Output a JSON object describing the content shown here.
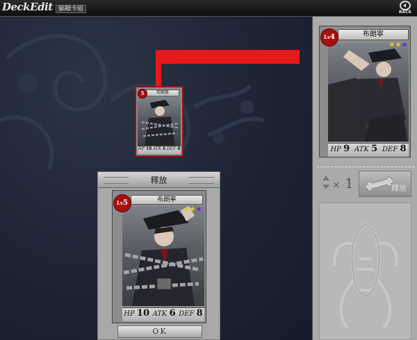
{
  "header": {
    "logo_text": "DeckEdit",
    "sub_label": "編輯卡組",
    "back_label": "BACK",
    "back_icon": "back-circle-arrow-icon"
  },
  "colors": {
    "arrow": "#e81818",
    "background": "#1c2333",
    "panel": "#aaaaaa",
    "level_badge": "#a81010"
  },
  "small_card": {
    "level": "5",
    "name": "布朗寧",
    "hp": "10",
    "atk": "6",
    "def": "8"
  },
  "release_panel": {
    "title": "釋放",
    "ok_label": "OK",
    "card": {
      "lv_label": "Lv",
      "level": "5",
      "name": "布朗寧",
      "hp_label": "HP",
      "hp": "10",
      "atk_label": "ATK",
      "atk": "6",
      "def_label": "DEF",
      "def": "8"
    }
  },
  "detail_card": {
    "lv_label": "Lv",
    "level": "4",
    "name": "布朗寧",
    "hp_label": "HP",
    "hp": "9",
    "atk_label": "ATK",
    "atk": "5",
    "def_label": "DEF",
    "def": "8"
  },
  "controls": {
    "quantity_prefix": "×",
    "quantity": "1",
    "release_button_label": "釋放"
  }
}
